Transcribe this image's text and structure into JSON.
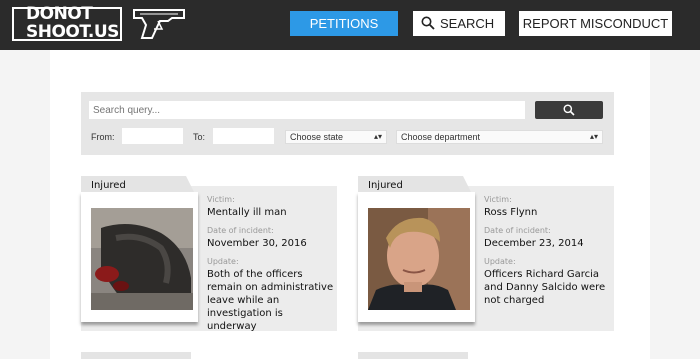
{
  "header": {
    "logo_line1": "DONOT",
    "logo_line2": "SHOOT.US",
    "nav": {
      "petitions": "PETITIONS",
      "search": "SEARCH",
      "report": "REPORT MISCONDUCT"
    }
  },
  "filters": {
    "search_placeholder": "Search query...",
    "from_label": "From:",
    "to_label": "To:",
    "state_select": "Choose state",
    "department_select": "Choose department"
  },
  "cards": [
    {
      "tag": "Injured",
      "victim_label": "Victim:",
      "victim": "Mentally ill man",
      "date_label": "Date of incident:",
      "date": "November 30, 2016",
      "update_label": "Update:",
      "update": "Both of the officers remain on administrative leave while an investigation is underway"
    },
    {
      "tag": "Injured",
      "victim_label": "Victim:",
      "victim": "Ross Flynn",
      "date_label": "Date of incident:",
      "date": "December 23, 2014",
      "update_label": "Update:",
      "update": "Officers Richard Garcia and Danny Salcido were not charged"
    }
  ],
  "colors": {
    "topbar": "#2b2b2b",
    "accent": "#2d99e6",
    "card_bg": "#ececec"
  }
}
